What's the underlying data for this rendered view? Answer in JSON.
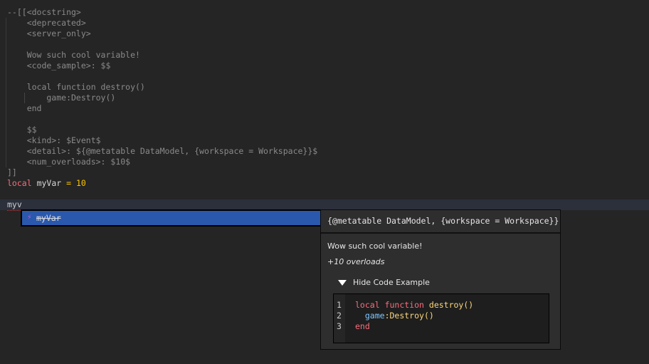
{
  "editor": {
    "lines": [
      "--[[<docstring>",
      "    <deprecated>",
      "    <server_only>",
      "",
      "    Wow such cool variable!",
      "    <code_sample>: $$",
      "",
      "    local function destroy()",
      "        game:Destroy()",
      "    end",
      "",
      "    $$",
      "    <kind>: $Event$",
      "    <detail>: ${@metatable DataModel, {workspace = Workspace}}$",
      "    <num_overloads>: $10$",
      "]]"
    ],
    "decl": {
      "keyword": "local",
      "name": "myVar",
      "op": "=",
      "value": "10"
    },
    "typed": "myv"
  },
  "autocomplete": {
    "icon": "event-icon",
    "item": "myVar"
  },
  "tooltip": {
    "detail": "{@metatable DataModel, {workspace = Workspace}}",
    "description": "Wow such cool variable!",
    "overloads": "+10 overloads",
    "toggle_label": "Hide Code Example",
    "code": {
      "line_numbers": [
        "1",
        "2",
        "3"
      ],
      "l1": {
        "kw1": "local",
        "kw2": "function",
        "fn": "destroy()"
      },
      "l2": {
        "obj": "game",
        "method": ":Destroy()"
      },
      "l3": {
        "kw": "end"
      }
    }
  }
}
